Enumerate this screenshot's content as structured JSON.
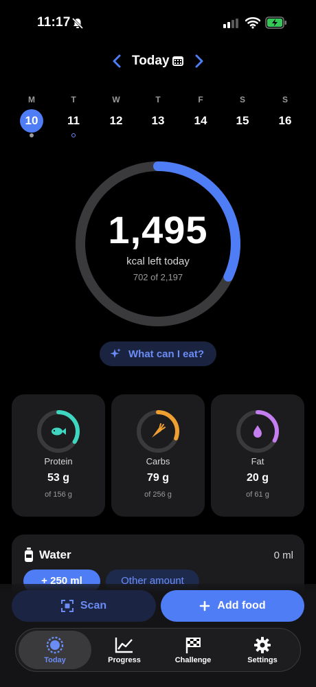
{
  "status_bar": {
    "time": "11:17"
  },
  "date_nav": {
    "title": "Today"
  },
  "week": [
    {
      "letter": "M",
      "number": "10",
      "active": true,
      "marker": "filled"
    },
    {
      "letter": "T",
      "number": "11",
      "active": false,
      "marker": "ring"
    },
    {
      "letter": "W",
      "number": "12",
      "active": false,
      "marker": "none"
    },
    {
      "letter": "T",
      "number": "13",
      "active": false,
      "marker": "none"
    },
    {
      "letter": "F",
      "number": "14",
      "active": false,
      "marker": "none"
    },
    {
      "letter": "S",
      "number": "15",
      "active": false,
      "marker": "none"
    },
    {
      "letter": "S",
      "number": "16",
      "active": false,
      "marker": "none"
    }
  ],
  "calories": {
    "left": "1,495",
    "label": "kcal left today",
    "summary": "702 of 2,197",
    "consumed": 702,
    "goal": 2197,
    "ring_color": "#4f7df5"
  },
  "ask": {
    "label": "What can I eat?",
    "icon": "sparkle-icon"
  },
  "macros": [
    {
      "name": "Protein",
      "amount": "53 g",
      "goal": "of 156 g",
      "consumed": 53,
      "target": 156,
      "color": "#3ed6c0",
      "icon": "fish-icon"
    },
    {
      "name": "Carbs",
      "amount": "79 g",
      "goal": "of 256 g",
      "consumed": 79,
      "target": 256,
      "color": "#f0a030",
      "icon": "carrot-icon"
    },
    {
      "name": "Fat",
      "amount": "20 g",
      "goal": "of 61 g",
      "consumed": 20,
      "target": 61,
      "color": "#c47ef0",
      "icon": "drop-icon"
    }
  ],
  "water": {
    "title": "Water",
    "value": "0 ml",
    "add_label": "+ 250 ml",
    "other_label": "Other amount"
  },
  "actions": {
    "scan_label": "Scan",
    "add_food_label": "Add food"
  },
  "tabs": [
    {
      "label": "Today",
      "icon": "today-icon",
      "active": true
    },
    {
      "label": "Progress",
      "icon": "chart-icon",
      "active": false
    },
    {
      "label": "Challenge",
      "icon": "flag-icon",
      "active": false
    },
    {
      "label": "Settings",
      "icon": "gear-icon",
      "active": false
    }
  ],
  "colors": {
    "accent": "#4f7df5",
    "card": "#1c1c1e"
  }
}
